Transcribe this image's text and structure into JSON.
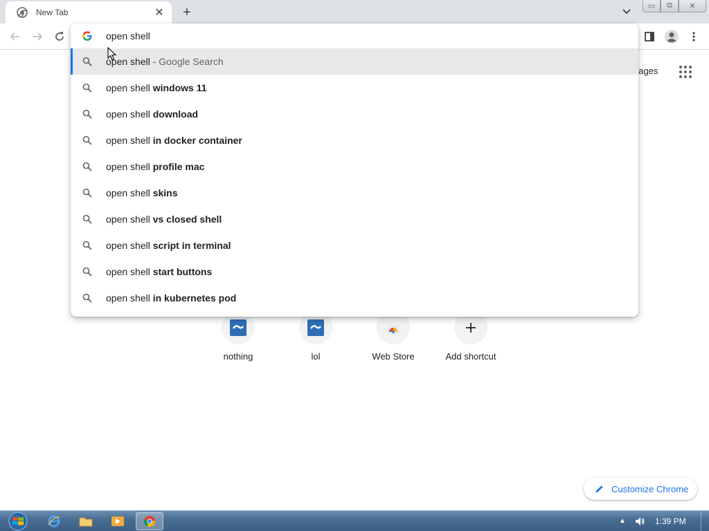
{
  "tab": {
    "title": "New Tab",
    "close_glyph": "✕",
    "icon": "chrome-icon"
  },
  "newtab_glyph": "+",
  "window": {
    "minimize": "▭",
    "restore": "⧉",
    "close": "✕"
  },
  "toolbar": {
    "back": "back-icon",
    "forward": "forward-icon",
    "reload": "reload-icon"
  },
  "omnibox": {
    "query": "open shell",
    "suggestions": [
      {
        "prefix": "open shell",
        "bold": "",
        "sub": " - Google Search",
        "selected": true
      },
      {
        "prefix": "open shell ",
        "bold": "windows 11",
        "sub": ""
      },
      {
        "prefix": "open shell ",
        "bold": "download",
        "sub": ""
      },
      {
        "prefix": "open shell ",
        "bold": "in docker container",
        "sub": ""
      },
      {
        "prefix": "open shell ",
        "bold": "profile mac",
        "sub": ""
      },
      {
        "prefix": "open shell ",
        "bold": "skins",
        "sub": ""
      },
      {
        "prefix": "open shell ",
        "bold": "vs closed shell",
        "sub": ""
      },
      {
        "prefix": "open shell ",
        "bold": "script in terminal",
        "sub": ""
      },
      {
        "prefix": "open shell ",
        "bold": "start buttons",
        "sub": ""
      },
      {
        "prefix": "open shell ",
        "bold": "in kubernetes pod",
        "sub": ""
      }
    ]
  },
  "page": {
    "images_link": "nages",
    "shortcuts": [
      {
        "label": "nothing"
      },
      {
        "label": "lol"
      },
      {
        "label": "Web Store"
      },
      {
        "label": "Add shortcut"
      }
    ],
    "customize_label": "Customize Chrome"
  },
  "taskbar": {
    "clock": "1:39 PM"
  },
  "colors": {
    "accent": "#1a73e8",
    "tabstrip": "#dee1e6",
    "taskbar": "#4a6d93"
  }
}
